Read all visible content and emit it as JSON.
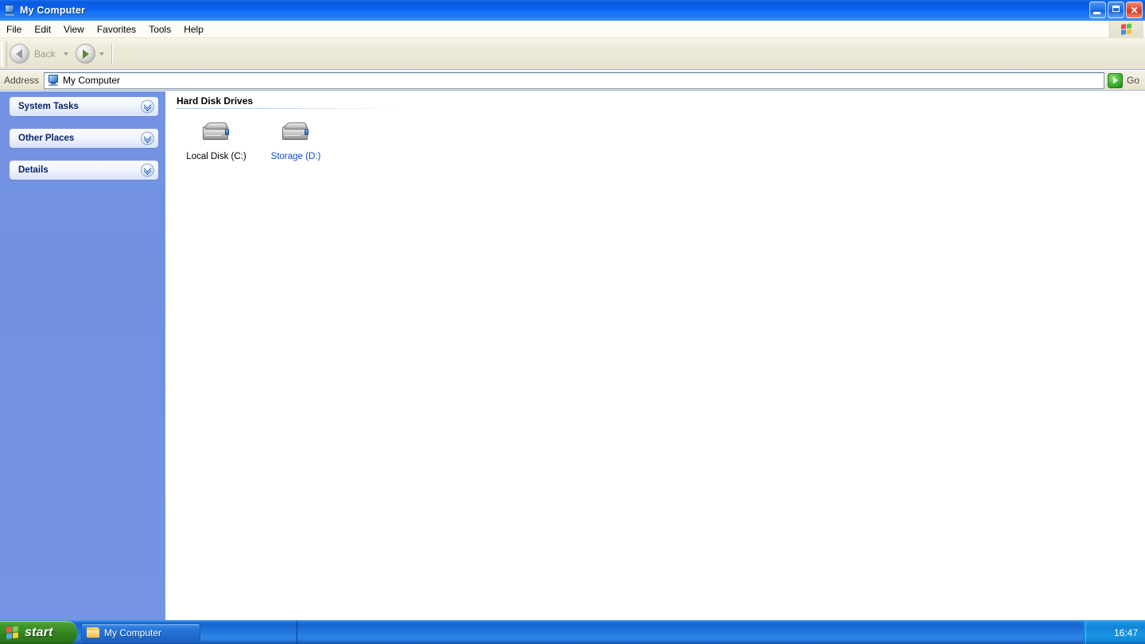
{
  "window": {
    "title": "My Computer",
    "icon": "my-computer-icon",
    "buttons": {
      "minimize": "Minimize",
      "maximize": "Maximize",
      "close": "Close"
    }
  },
  "menubar": {
    "items": [
      {
        "label": "File"
      },
      {
        "label": "Edit"
      },
      {
        "label": "View"
      },
      {
        "label": "Favorites"
      },
      {
        "label": "Tools"
      },
      {
        "label": "Help"
      }
    ],
    "logo": "windows-flag-icon"
  },
  "toolbar": {
    "back_label": "Back",
    "back_icon": "back-arrow-icon",
    "forward_icon": "forward-arrow-icon",
    "back_caret": "chevron-down-icon",
    "forward_caret": "chevron-down-icon"
  },
  "address": {
    "label": "Address",
    "value": "My Computer",
    "icon": "my-computer-icon",
    "go_label": "Go",
    "go_icon": "go-arrow-icon"
  },
  "sidebar": {
    "panels": [
      {
        "title": "System Tasks",
        "chevron": "chevron-double-down-icon"
      },
      {
        "title": "Other Places",
        "chevron": "chevron-double-down-icon"
      },
      {
        "title": "Details",
        "chevron": "chevron-double-down-icon"
      }
    ]
  },
  "content": {
    "group_title": "Hard Disk Drives",
    "items": [
      {
        "label": "Local Disk (C:)",
        "icon": "hard-drive-icon",
        "highlighted": false
      },
      {
        "label": "Storage (D:)",
        "icon": "hard-drive-icon",
        "highlighted": true
      }
    ]
  },
  "taskbar": {
    "start_label": "start",
    "start_icon": "windows-flag-icon",
    "tasks": [
      {
        "label": "My Computer",
        "icon": "folder-icon"
      }
    ],
    "clock": "16:47"
  },
  "colors": {
    "titlebar_blue": "#0A5BE0",
    "toolbar_beige": "#EDE9D8",
    "sidebar_blue": "#7190E0",
    "panel_title": "#0A246A",
    "highlight_link": "#0B4CD4",
    "start_green": "#3A8E26",
    "taskbar_blue": "#2479DE",
    "close_red": "#D13B22",
    "go_green": "#2E9B26"
  }
}
